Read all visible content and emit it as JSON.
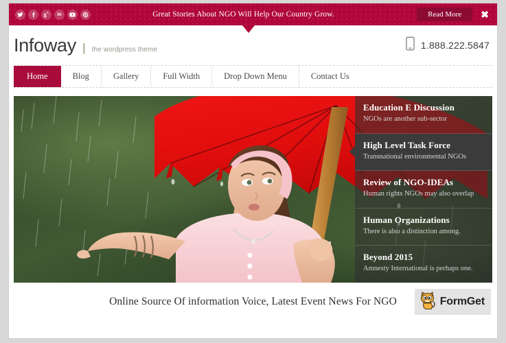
{
  "promo": {
    "message": "Great Stories About NGO Will Help Our Country Grow.",
    "read_more_label": "Read More",
    "close_label": "✖",
    "bar_color": "#b0063c",
    "button_color": "#8d0a34",
    "social": [
      {
        "name": "twitter-icon",
        "glyph": "t"
      },
      {
        "name": "facebook-icon",
        "glyph": "f"
      },
      {
        "name": "google-plus-icon",
        "glyph": "g+"
      },
      {
        "name": "linkedin-icon",
        "glyph": "in"
      },
      {
        "name": "youtube-icon",
        "glyph": "▶"
      },
      {
        "name": "pinterest-icon",
        "glyph": "P"
      }
    ]
  },
  "header": {
    "brand_name": "Infoway",
    "brand_separator": "|",
    "tagline": "the wordpress theme",
    "phone_icon": "mobile-phone-icon",
    "phone": "1.888.222.5847"
  },
  "nav": {
    "items": [
      {
        "label": "Home",
        "active": true
      },
      {
        "label": "Blog",
        "active": false
      },
      {
        "label": "Gallery",
        "active": false
      },
      {
        "label": "Full Width",
        "active": false
      },
      {
        "label": "Drop Down Menu",
        "active": false
      },
      {
        "label": "Contact Us",
        "active": false
      }
    ],
    "active_color": "#a90b3b"
  },
  "slider": {
    "image_description": "Girl in pink dress holding a red umbrella in the rain",
    "items": [
      {
        "title": "Education E Discussion",
        "subtitle": "NGOs are another sub-sector",
        "active": false
      },
      {
        "title": "High Level Task Force",
        "subtitle": "Transnational environmental NGOs",
        "active": true
      },
      {
        "title": "Review of NGO-IDEAs",
        "subtitle": "Human rights NGOs may also overlap",
        "active": false
      },
      {
        "title": "Human Organizations",
        "subtitle": "There is also a distinction among.",
        "active": false
      },
      {
        "title": "Beyond 2015",
        "subtitle": "Amnesty International is perhaps one.",
        "active": false
      }
    ]
  },
  "footer": {
    "tagline": "Online Source Of information Voice, Latest Event News For NGO",
    "badge_label": "FormGet",
    "badge_icon": "cat-mascot-icon"
  }
}
